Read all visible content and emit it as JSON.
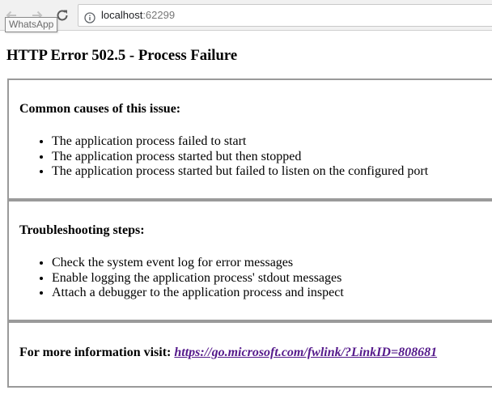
{
  "browser": {
    "address_host": "localhost",
    "address_port": ":62299",
    "tooltip": "WhatsApp",
    "icons": {
      "back": "back-arrow-icon",
      "forward": "forward-arrow-icon",
      "reload": "reload-icon",
      "info": "info-icon"
    }
  },
  "page": {
    "title": "HTTP Error 502.5 - Process Failure",
    "causes": {
      "heading": "Common causes of this issue:",
      "items": [
        "The application process failed to start",
        "The application process started but then stopped",
        "The application process started but failed to listen on the configured port"
      ]
    },
    "steps": {
      "heading": "Troubleshooting steps:",
      "items": [
        "Check the system event log for error messages",
        "Enable logging the application process' stdout messages",
        "Attach a debugger to the application process and inspect"
      ]
    },
    "more_info": {
      "label": "For more information visit:",
      "link_text": "https://go.microsoft.com/fwlink/?LinkID=808681"
    }
  },
  "colors": {
    "link_visited": "#551a8b",
    "panel_border": "#9a9a9a"
  }
}
